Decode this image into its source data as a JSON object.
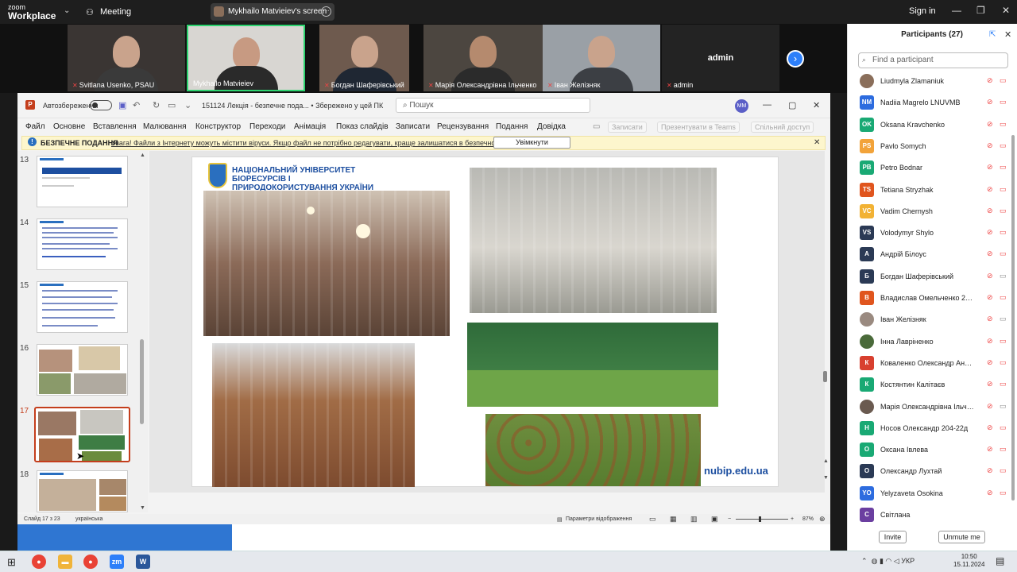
{
  "zoom": {
    "brand_line1": "zoom",
    "brand_line2": "Workplace",
    "meeting_label": "Meeting",
    "screen_share_label": "Mykhailo Matvieiev's screen",
    "signin": "Sign in",
    "videos": [
      {
        "name": "Svitlana Usenko, PSAU"
      },
      {
        "name": "Mykhailo Matvieiev"
      },
      {
        "name": "Богдан Шаферівський"
      },
      {
        "name": "Марія Олександрівна Ільченко"
      },
      {
        "name": "Іван Желізняк"
      },
      {
        "name": "admin"
      }
    ],
    "admin_tile_title": "admin"
  },
  "ppt": {
    "autosave_label": "Автозбереження",
    "doc_title": "151124 Лекція  -  безпечне пода...  •  Збережено у цей ПК",
    "search_placeholder": "Пошук",
    "user_initials": "MM",
    "ribbon": [
      "Файл",
      "Основне",
      "Вставлення",
      "Малювання",
      "Конструктор",
      "Переходи",
      "Анімація",
      "Показ слайдів",
      "Записати",
      "Рецензування",
      "Подання",
      "Довідка"
    ],
    "ribbon_right": [
      "Записати",
      "Презентувати в Teams",
      "Спільний доступ"
    ],
    "protected_title": "БЕЗПЕЧНЕ ПОДАННЯ",
    "protected_msg": "Увага! Файли з Інтернету можуть містити віруси. Якщо файл не потрібно редагувати, краще залишатися в безпечному поданні.",
    "protected_button": "Увімкнути редагування",
    "thumb_numbers": [
      "13",
      "14",
      "15",
      "16",
      "17",
      "18"
    ],
    "slide": {
      "university": "НАЦІОНАЛЬНИЙ УНІВЕРСИТЕТ БІОРЕСУРСІВ І ПРИРОДОКОРИСТУВАННЯ УКРАЇНИ",
      "url": "nubip.edu.ua"
    },
    "status": {
      "slide": "Слайд 17 з 23",
      "language": "українська",
      "view_params": "Параметри відображення",
      "zoom": "87%"
    }
  },
  "panel": {
    "title": "Participants (27)",
    "search_placeholder": "Find a participant",
    "participants": [
      {
        "name": "Liudmyla Zlamaniuk",
        "initials": "",
        "color": "#8a6e5a"
      },
      {
        "name": "Nadiia Magrelo LNUVMB",
        "initials": "NM",
        "color": "#2d6cdf"
      },
      {
        "name": "Oksana Kravchenko",
        "initials": "OK",
        "color": "#19a974"
      },
      {
        "name": "Pavlo Somych",
        "initials": "PS",
        "color": "#f2a33a"
      },
      {
        "name": "Petro Bodnar",
        "initials": "PB",
        "color": "#19a974"
      },
      {
        "name": "Tetiana Stryzhak",
        "initials": "TS",
        "color": "#e0551e"
      },
      {
        "name": "Vadim Chernysh",
        "initials": "VC",
        "color": "#f2b234"
      },
      {
        "name": "Volodymyr Shylo",
        "initials": "VS",
        "color": "#2b3a55"
      },
      {
        "name": "Андрій Білоус",
        "initials": "A",
        "color": "#2b3a55"
      },
      {
        "name": "Богдан Шаферівський",
        "initials": "Б",
        "color": "#2b3a55"
      },
      {
        "name": "Владислав Омельченко 204-2...",
        "initials": "В",
        "color": "#e0551e"
      },
      {
        "name": "Іван Желізняк",
        "initials": "",
        "color": "#9a8a80"
      },
      {
        "name": "Інна Лавріненко",
        "initials": "",
        "color": "#4a6a3a"
      },
      {
        "name": "Коваленко Олександр Анатол...",
        "initials": "К",
        "color": "#d8402f"
      },
      {
        "name": "Костянтин Калітаєв",
        "initials": "К",
        "color": "#19a974"
      },
      {
        "name": "Марія Олександрівна Ільченко",
        "initials": "",
        "color": "#6a5a50"
      },
      {
        "name": "Носов Олександр 204-22д",
        "initials": "Н",
        "color": "#19a974"
      },
      {
        "name": "Оксана Івлева",
        "initials": "О",
        "color": "#19a974"
      },
      {
        "name": "Олександр Лухтай",
        "initials": "О",
        "color": "#2b3a55"
      },
      {
        "name": "Yelyzaveta Osokina",
        "initials": "YO",
        "color": "#2d6cdf"
      },
      {
        "name": "Світлана",
        "initials": "С",
        "color": "#6b3fa0"
      }
    ],
    "invite": "Invite",
    "unmute": "Unmute me"
  },
  "taskbar": {
    "lang": "УКР",
    "time": "10:50",
    "date": "15.11.2024"
  }
}
